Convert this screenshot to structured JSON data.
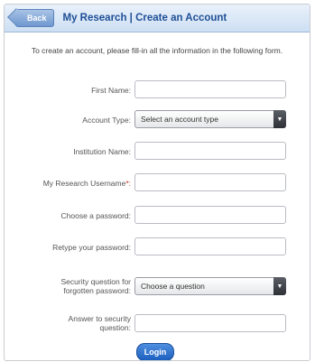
{
  "header": {
    "back_label": "Back",
    "title": "My Research | Create an Account"
  },
  "intro_text": "To create an account, please fill-in all the information in the following form.",
  "form": {
    "first_name_label": "First Name:",
    "account_type_label": "Account Type:",
    "account_type_value": "Select an account type",
    "institution_label": "Institution Name:",
    "username_label": "My Research Username",
    "username_required_mark": "*:",
    "password_label": "Choose a password:",
    "retype_password_label": "Retype your password:",
    "security_question_label_1": "Security question for",
    "security_question_label_2": "forgotten password:",
    "security_question_value": "Choose a question",
    "answer_label_1": "Answer to security",
    "answer_label_2": "question:",
    "submit_label": "Login"
  },
  "colors": {
    "title": "#1f4f96",
    "button_blue": "#1d5fbf"
  }
}
